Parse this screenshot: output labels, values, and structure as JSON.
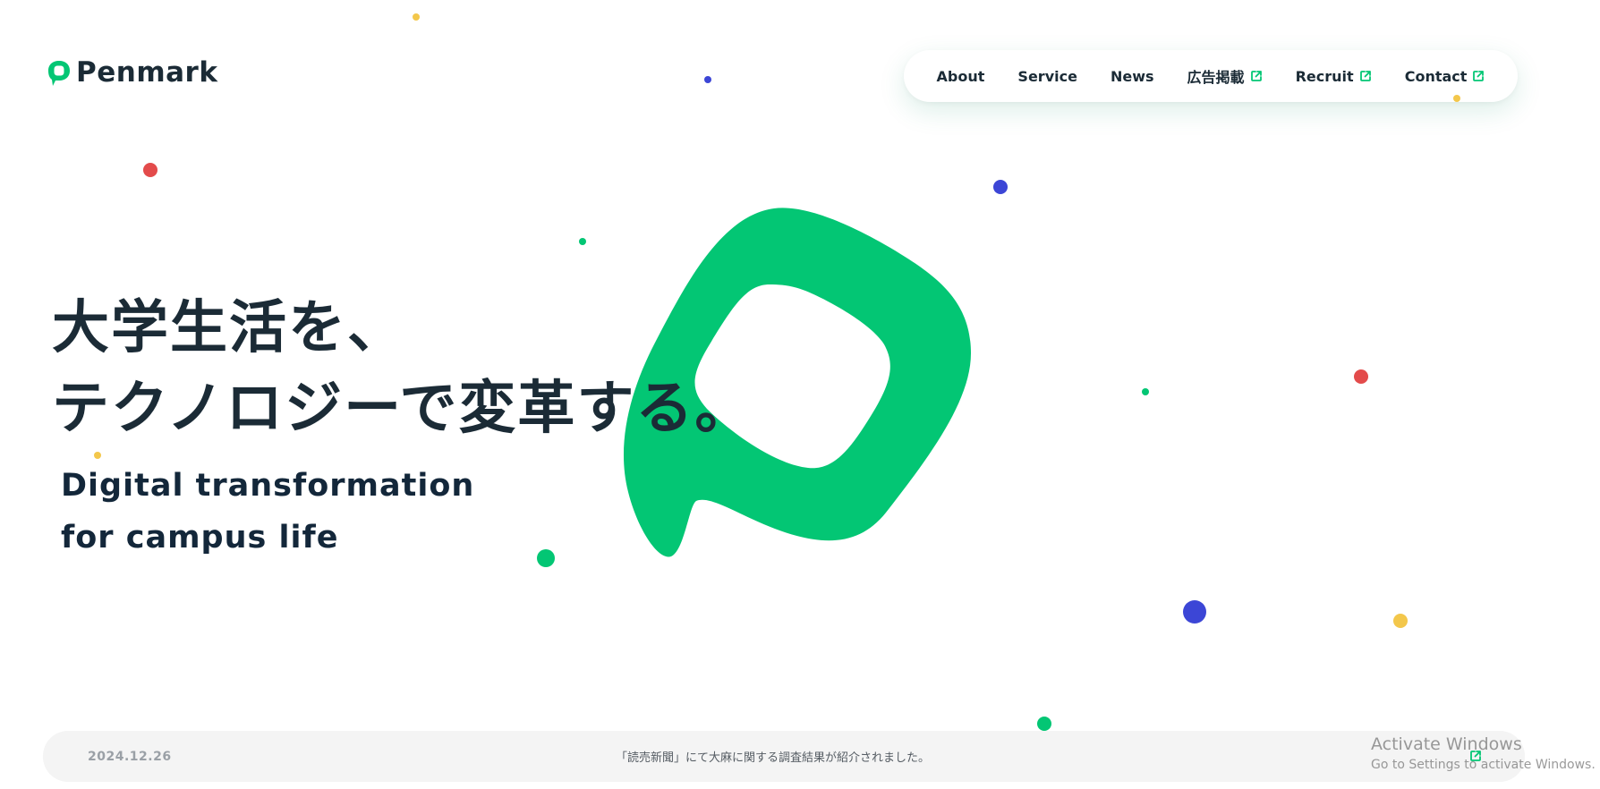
{
  "header": {
    "logo_text": "Penmark",
    "brand_color": "#03c674"
  },
  "nav": {
    "items": [
      {
        "label": "About",
        "external": false
      },
      {
        "label": "Service",
        "external": false
      },
      {
        "label": "News",
        "external": false
      },
      {
        "label": "広告掲載",
        "external": true
      },
      {
        "label": "Recruit",
        "external": true
      },
      {
        "label": "Contact",
        "external": true
      }
    ],
    "external_icon": "external-link-icon"
  },
  "hero": {
    "headline_line1": "大学生活を、",
    "headline_line2": "テクノロジーで変革する。",
    "subheadline_line1": "Digital transformation",
    "subheadline_line2": "for campus life",
    "mark_icon": "penmark-logo-mark",
    "dot_colors": [
      "#03c674",
      "#3c46d6",
      "#e34b4b",
      "#f3c74b"
    ]
  },
  "news": {
    "date": "2024.12.26",
    "title": "「読売新聞」にて大麻に関する調査結果が紹介されました。",
    "link_icon": "external-link-icon"
  },
  "watermark": {
    "title": "Activate Windows",
    "subtitle": "Go to Settings to activate Windows."
  }
}
